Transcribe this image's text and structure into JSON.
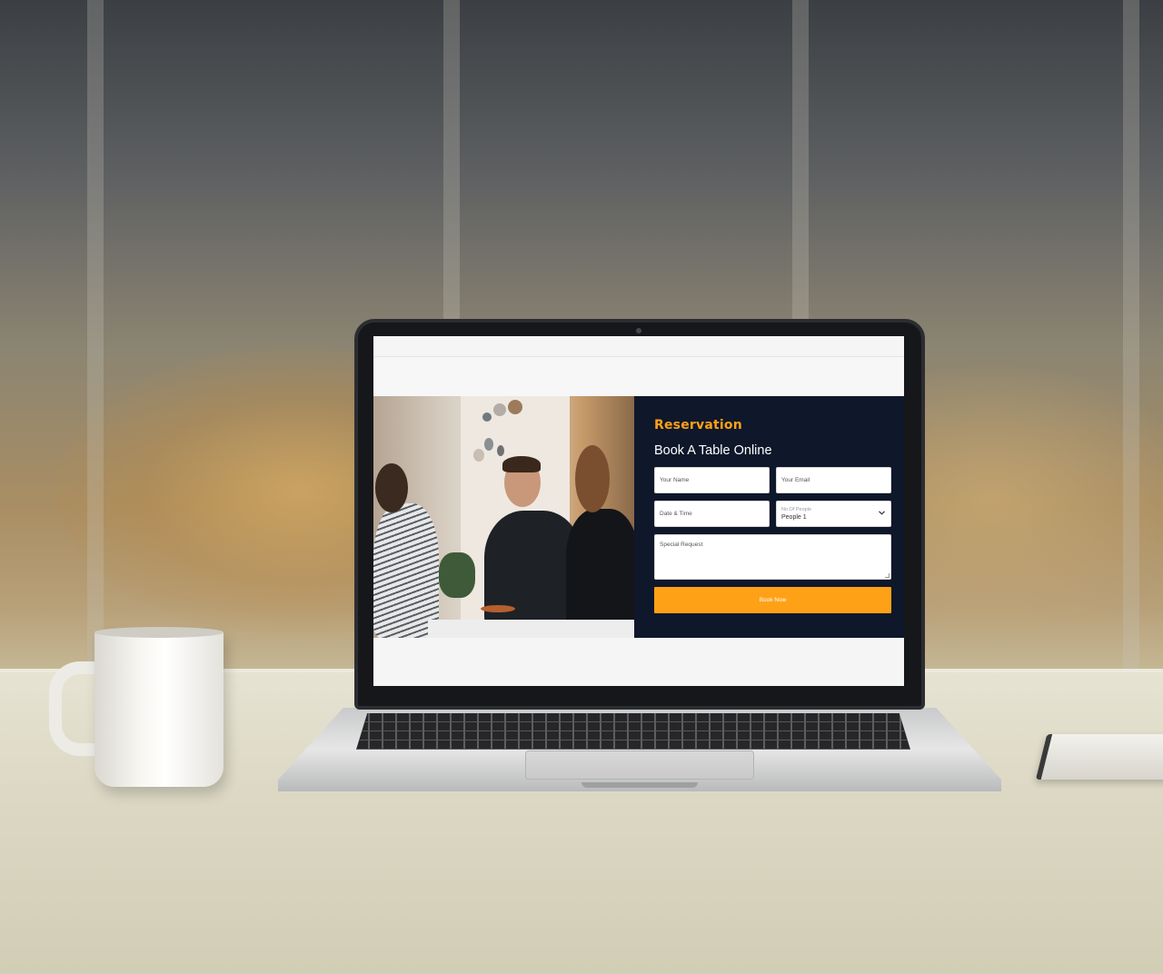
{
  "reservation": {
    "kicker": "Reservation",
    "title": "Book A Table Online",
    "name_placeholder": "Your Name",
    "email_placeholder": "Your Email",
    "datetime_placeholder": "Date & Time",
    "people_label": "No Of People",
    "people_value": "People 1",
    "request_placeholder": "Special Request",
    "submit_label": "Book Now"
  },
  "colors": {
    "accent": "#fea116",
    "panel": "#0f172b"
  },
  "icons": {
    "select_arrow": "chevron-down-icon"
  }
}
